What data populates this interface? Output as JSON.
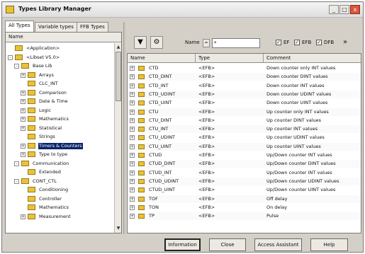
{
  "window": {
    "title": "Types Library Manager"
  },
  "window_buttons": {
    "minimize": "_",
    "maximize": "□",
    "close": "x"
  },
  "tabs": [
    {
      "label": "All Types"
    },
    {
      "label": "Variable types"
    },
    {
      "label": "FFB Types"
    }
  ],
  "tree": {
    "header": "Name",
    "items": [
      {
        "label": "<Application>",
        "expander": ""
      },
      {
        "label": "<Libset V5.0>",
        "expander": "-"
      },
      {
        "label": "Base Lib",
        "expander": "-"
      },
      {
        "label": "Arrays",
        "expander": "+"
      },
      {
        "label": "CLC_INT",
        "expander": ""
      },
      {
        "label": "Comparison",
        "expander": "+"
      },
      {
        "label": "Date & Time",
        "expander": "+"
      },
      {
        "label": "Logic",
        "expander": "+"
      },
      {
        "label": "Mathematics",
        "expander": "+"
      },
      {
        "label": "Statistical",
        "expander": "+"
      },
      {
        "label": "Strings",
        "expander": ""
      },
      {
        "label": "Timers & Counters",
        "expander": "+",
        "selected": true
      },
      {
        "label": "Type to type",
        "expander": "+"
      },
      {
        "label": "Communication",
        "expander": "-"
      },
      {
        "label": "Extended",
        "expander": ""
      },
      {
        "label": "CONT_CTL",
        "expander": "-"
      },
      {
        "label": "Conditioning",
        "expander": ""
      },
      {
        "label": "Controller",
        "expander": ""
      },
      {
        "label": "Mathematics",
        "expander": ""
      },
      {
        "label": "Measurement",
        "expander": "+"
      }
    ]
  },
  "toolbar": {
    "filter_icon": "▼",
    "settings_icon": "⚙",
    "name_label": "Name",
    "name_sort_arrow": "=",
    "filter_value": "*",
    "ef_label": "EF",
    "efb_label": "EFB",
    "dfb_label": "DFB",
    "ef_checked": "✓",
    "efb_checked": "✓",
    "dfb_checked": "✓",
    "more_icon": "»"
  },
  "table": {
    "columns": [
      "Name",
      "Type",
      "Comment"
    ],
    "rows": [
      {
        "name": "CTD",
        "type": "<EFB>",
        "comment": "Down counter only INT values"
      },
      {
        "name": "CTD_DINT",
        "type": "<EFB>",
        "comment": "Down counter DINT values"
      },
      {
        "name": "CTD_INT",
        "type": "<EFB>",
        "comment": "Down counter INT values"
      },
      {
        "name": "CTD_UDINT",
        "type": "<EFB>",
        "comment": "Down counter UDINT values"
      },
      {
        "name": "CTD_UINT",
        "type": "<EFB>",
        "comment": "Down counter UINT values"
      },
      {
        "name": "CTU",
        "type": "<EFB>",
        "comment": "Up counter only INT values"
      },
      {
        "name": "CTU_DINT",
        "type": "<EFB>",
        "comment": "Up counter DINT values"
      },
      {
        "name": "CTU_INT",
        "type": "<EFB>",
        "comment": "Up counter INT values"
      },
      {
        "name": "CTU_UDINT",
        "type": "<EFB>",
        "comment": "Up counter UDINT values"
      },
      {
        "name": "CTU_UINT",
        "type": "<EFB>",
        "comment": "Up counter UINT values"
      },
      {
        "name": "CTUD",
        "type": "<EFB>",
        "comment": "Up/Down counter INT values"
      },
      {
        "name": "CTUD_DINT",
        "type": "<EFB>",
        "comment": "Up/Down counter DINT values"
      },
      {
        "name": "CTUD_INT",
        "type": "<EFB>",
        "comment": "Up/Down counter INT values"
      },
      {
        "name": "CTUD_UDINT",
        "type": "<EFB>",
        "comment": "Up/Down counter UDINT values"
      },
      {
        "name": "CTUD_UINT",
        "type": "<EFB>",
        "comment": "Up/Down counter UINT values"
      },
      {
        "name": "TOF",
        "type": "<EFB>",
        "comment": "Off delay"
      },
      {
        "name": "TON",
        "type": "<EFB>",
        "comment": "On delay"
      },
      {
        "name": "TP",
        "type": "<EFB>",
        "comment": "Pulse"
      }
    ]
  },
  "buttons": {
    "information": "Information",
    "close": "Close",
    "access_assistant": "Access Assistant",
    "help": "Help"
  }
}
